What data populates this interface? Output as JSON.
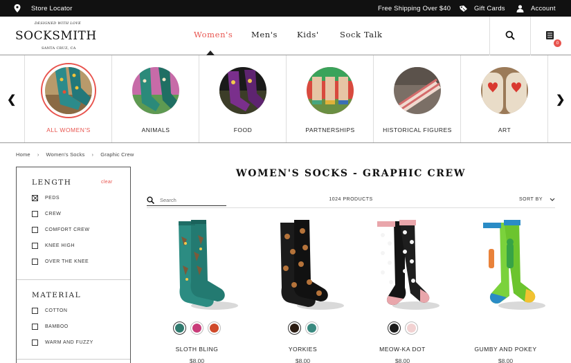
{
  "topbar": {
    "store_locator": "Store Locator",
    "free_shipping": "Free Shipping Over $40",
    "gift_cards": "Gift Cards",
    "account": "Account"
  },
  "logo": {
    "tagline_top": "DESIGNED WITH LOVE",
    "wordmark": "SOCKSMITH",
    "tagline_bottom": "SANTA CRUZ, CA"
  },
  "nav": {
    "items": [
      "Women's",
      "Men's",
      "Kids'",
      "Sock Talk"
    ],
    "active": "Women's"
  },
  "cart": {
    "count": "0"
  },
  "categories": [
    {
      "label": "ALL WOMEN'S",
      "active": true
    },
    {
      "label": "ANIMALS"
    },
    {
      "label": "FOOD"
    },
    {
      "label": "PARTNERSHIPS"
    },
    {
      "label": "HISTORICAL FIGURES"
    },
    {
      "label": "ART"
    }
  ],
  "breadcrumb": [
    "Home",
    "Women's Socks",
    "Graphic Crew"
  ],
  "filters": {
    "length": {
      "title": "LENGTH",
      "clear": "clear",
      "options": [
        "PEDS",
        "CREW",
        "COMFORT CREW",
        "KNEE HIGH",
        "OVER THE KNEE"
      ],
      "checked": "PEDS"
    },
    "material": {
      "title": "MATERIAL",
      "options": [
        "COTTON",
        "BAMBOO",
        "WARM AND FUZZY"
      ]
    }
  },
  "main": {
    "title": "WOMEN'S SOCKS - GRAPHIC CREW",
    "search_placeholder": "Search",
    "product_count": "1024 PRODUCTS",
    "sort_label": "SORT BY"
  },
  "products": [
    {
      "name": "SLOTH BLING",
      "price": "$8.00",
      "swatches": [
        "#2f7a6e",
        "#c93d7a",
        "#d04a2a"
      ]
    },
    {
      "name": "YORKIES",
      "price": "$8.00",
      "swatches": [
        "#2b1c12",
        "#3a8a80"
      ]
    },
    {
      "name": "MEOW-KA DOT",
      "price": "$8.00",
      "swatches": [
        "#1b1b1b",
        "#f2d2d2"
      ]
    },
    {
      "name": "GUMBY AND POKEY",
      "price": "$8.00",
      "swatches": []
    }
  ],
  "colors": {
    "accent": "#e8544e",
    "topbar": "#111111"
  }
}
